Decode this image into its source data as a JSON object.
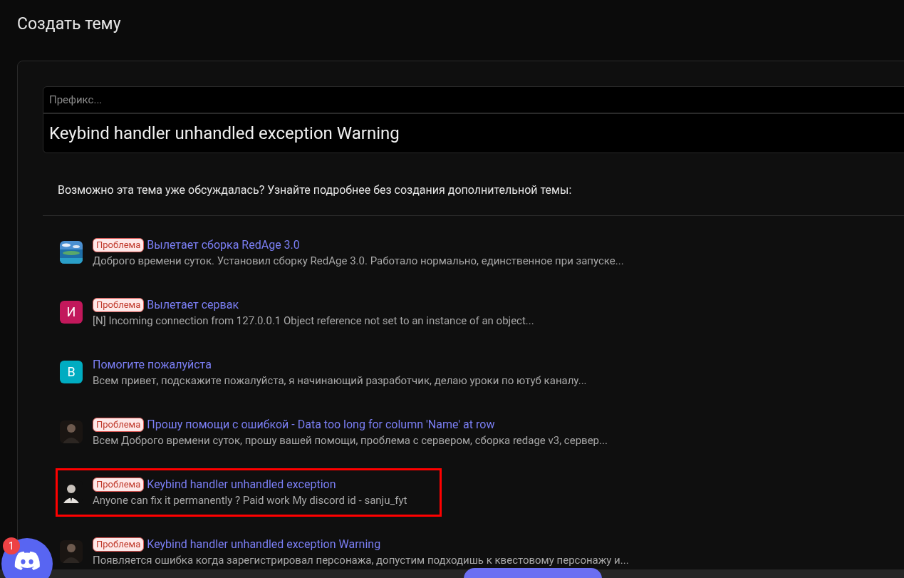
{
  "page_title": "Создать тему",
  "prefix_field": {
    "placeholder": "Префикс..."
  },
  "title_field": {
    "value": "Keybind handler unhandled exception Warning"
  },
  "suggestions_heading": "Возможно эта тема уже обсуждалась? Узнайте подробнее без создания дополнительной темы:",
  "threads": [
    {
      "prefix": "Проблема",
      "title": "Вылетает сборка RedAge 3.0",
      "snippet": "Доброго времени суток. Установил сборку RedAge 3.0. Работало нормально, единственное при запуске...",
      "highlighted": false
    },
    {
      "avatar": {
        "kind": "letter",
        "letter": "И",
        "color": "#c2185b"
      },
      "prefix": "Проблема",
      "title": "Вылетает сервак",
      "snippet": "[N] Incoming connection from 127.0.0.1 Object reference not set to an instance of an object...",
      "highlighted": false
    },
    {
      "avatar": {
        "kind": "letter",
        "letter": "В",
        "color": "#00acc1"
      },
      "title": "Помогите пожалуйста",
      "snippet": "Всем привет, подскажите пожалуйста, я начинающий разработчик, делаю уроки по ютуб каналу...",
      "highlighted": false
    },
    {
      "prefix": "Проблема",
      "title": "Прошу помощи с ошибкой - Data too long for column 'Name' at row",
      "snippet": "Всем Доброго времени суток, прошу вашей помощи, проблема с сервером, сборка redage v3, сервер...",
      "highlighted": false
    },
    {
      "prefix": "Проблема",
      "title": "Keybind handler unhandled exception",
      "snippet": "Anyone can fix it permanently ? Paid work My discord id - sanju_fyt",
      "highlighted": true
    },
    {
      "prefix": "Проблема",
      "title": "Keybind handler unhandled exception Warning",
      "snippet": "Появляется ошибка когда зарегистрировал персонажа, допустим подходишь к квестовому персонажу и...",
      "highlighted": false
    }
  ],
  "chat_button": {
    "badge": "1"
  }
}
